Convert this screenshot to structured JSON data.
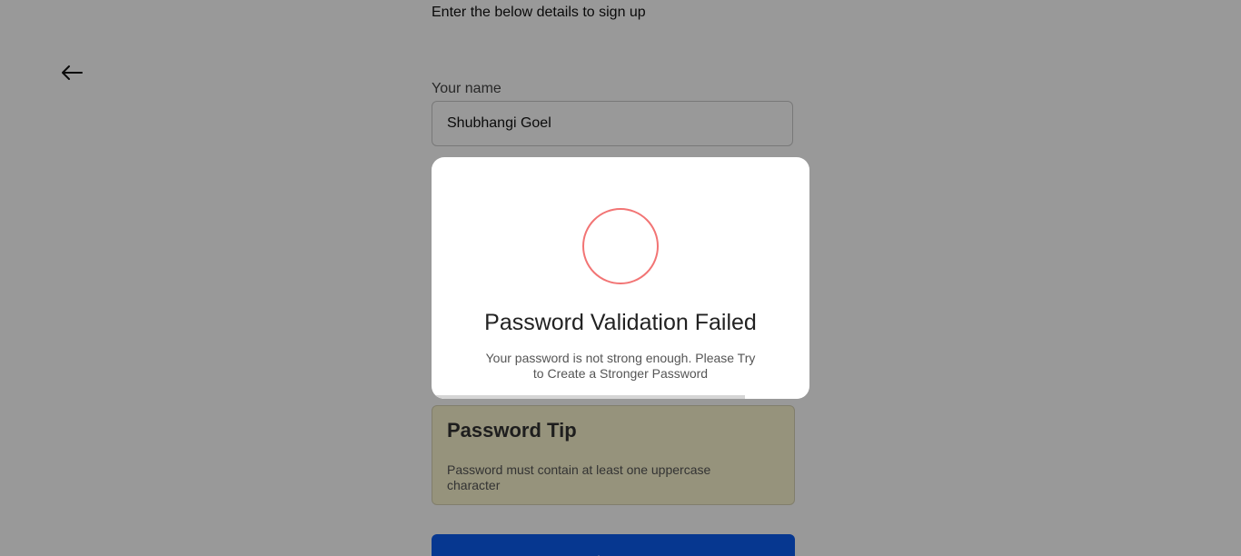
{
  "page": {
    "subtitle": "Enter the below details to sign up",
    "back_icon": "arrow-left-icon",
    "name_label": "Your name",
    "name_value": "Shubhangi Goel",
    "password_tip": {
      "title": "Password Tip",
      "text": "Password must contain at least one uppercase character"
    },
    "signup_label": "Sign Up"
  },
  "modal": {
    "icon": "error-circle-icon",
    "title": "Password Validation Failed",
    "message": "Your password is not strong enough. Please Try to Create a Stronger Password",
    "timer_progress_fraction": 0.83
  },
  "colors": {
    "error": "#f27474",
    "primary": "#0b5cf0",
    "tip_background": "#fbf6cf",
    "backdrop": "rgba(0,0,0,0.40)"
  }
}
